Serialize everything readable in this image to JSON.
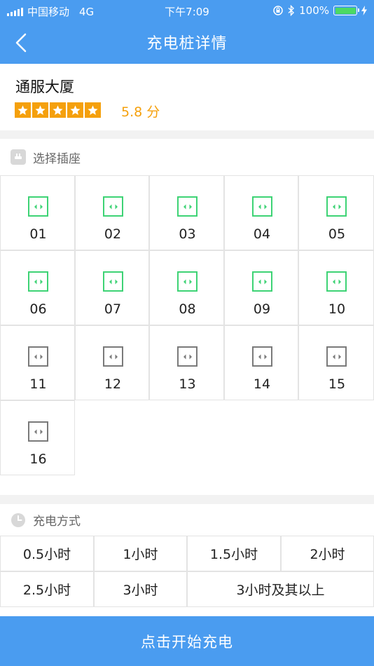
{
  "status_bar": {
    "carrier": "中国移动",
    "network": "4G",
    "time": "下午7:09",
    "battery": "100%"
  },
  "nav": {
    "title": "充电桩详情"
  },
  "station": {
    "name": "通服大厦",
    "rating": 5,
    "score": "5.8 分"
  },
  "socket_section": {
    "title": "选择插座",
    "sockets": [
      {
        "number": "01",
        "available": true
      },
      {
        "number": "02",
        "available": true
      },
      {
        "number": "03",
        "available": true
      },
      {
        "number": "04",
        "available": true
      },
      {
        "number": "05",
        "available": true
      },
      {
        "number": "06",
        "available": true
      },
      {
        "number": "07",
        "available": true
      },
      {
        "number": "08",
        "available": true
      },
      {
        "number": "09",
        "available": true
      },
      {
        "number": "10",
        "available": true
      },
      {
        "number": "11",
        "available": false
      },
      {
        "number": "12",
        "available": false
      },
      {
        "number": "13",
        "available": false
      },
      {
        "number": "14",
        "available": false
      },
      {
        "number": "15",
        "available": false
      },
      {
        "number": "16",
        "available": false
      }
    ]
  },
  "mode_section": {
    "title": "充电方式",
    "options": [
      "0.5小时",
      "1小时",
      "1.5小时",
      "2小时",
      "2.5小时",
      "3小时",
      "3小时及其以上"
    ]
  },
  "start_button": {
    "label": "点击开始充电"
  },
  "colors": {
    "brand_blue": "#4a9cf0",
    "available_green": "#3ed375",
    "unavailable_gray": "#7a7a7a",
    "rating_orange": "#f5a00c",
    "battery_green": "#4cd964"
  }
}
